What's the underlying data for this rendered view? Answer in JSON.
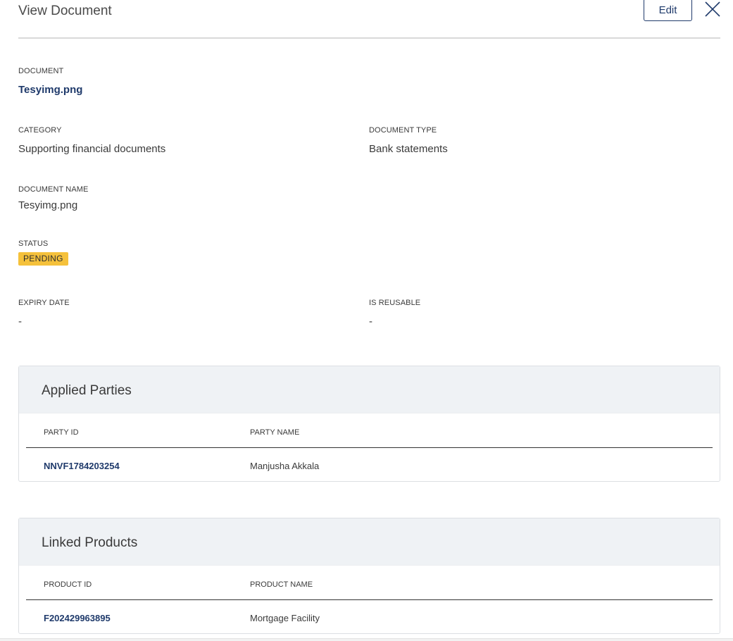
{
  "header": {
    "title": "View Document",
    "edit_label": "Edit",
    "close_icon": "close-icon"
  },
  "document": {
    "label": "DOCUMENT",
    "value": "Tesyimg.png"
  },
  "category": {
    "label": "CATEGORY",
    "value": "Supporting financial documents"
  },
  "document_type": {
    "label": "DOCUMENT TYPE",
    "value": "Bank statements"
  },
  "document_name": {
    "label": "DOCUMENT NAME",
    "value": "Tesyimg.png"
  },
  "status": {
    "label": "STATUS",
    "value": "PENDING",
    "color": "#f5c13b"
  },
  "expiry_date": {
    "label": "EXPIRY DATE",
    "value": "-"
  },
  "is_reusable": {
    "label": "IS REUSABLE",
    "value": "-"
  },
  "applied_parties": {
    "title": "Applied Parties",
    "columns": [
      "PARTY ID",
      "PARTY NAME"
    ],
    "rows": [
      {
        "party_id": "NNVF1784203254",
        "party_name": "Manjusha Akkala"
      }
    ]
  },
  "linked_products": {
    "title": "Linked Products",
    "columns": [
      "PRODUCT ID",
      "PRODUCT NAME"
    ],
    "rows": [
      {
        "product_id": "F202429963895",
        "product_name": "Mortgage Facility"
      }
    ]
  },
  "colors": {
    "link": "#1f3a6b",
    "panel_header": "#eff2f5",
    "status_pending": "#f5c13b"
  }
}
